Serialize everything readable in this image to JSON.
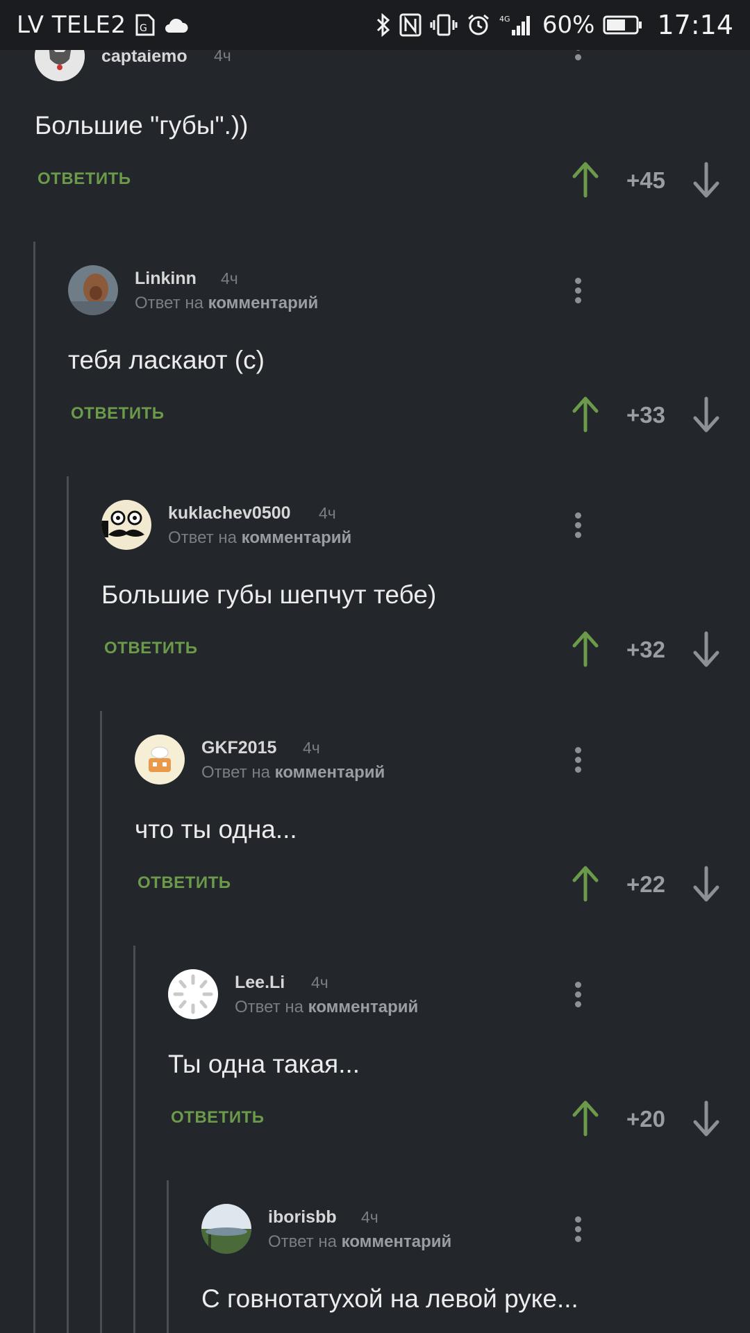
{
  "status_bar": {
    "carrier": "LV TELE2",
    "network": "4G",
    "battery_percent": "60%",
    "time": "17:14",
    "icons": [
      "sim-card-icon",
      "cloud-icon",
      "bluetooth-icon",
      "nfc-icon",
      "vibrate-icon",
      "alarm-icon",
      "signal-icon",
      "battery-icon"
    ]
  },
  "colors": {
    "background": "#23262b",
    "accent_green": "#6a9a4a",
    "muted": "#7b7e83"
  },
  "reply_label": "ОТВЕТИТЬ",
  "reply_prefix": "Ответ на",
  "reply_target": "комментарий",
  "comments": [
    {
      "author": "captaiemo",
      "time": "4ч",
      "text": "Большие \"губы\".))",
      "score": "+45",
      "is_reply": false
    },
    {
      "author": "Linkinn",
      "time": "4ч",
      "text": "тебя ласкают (с)",
      "score": "+33",
      "is_reply": true
    },
    {
      "author": "kuklachev0500",
      "time": "4ч",
      "text": "Большие губы шепчут тебе)",
      "score": "+32",
      "is_reply": true
    },
    {
      "author": "GKF2015",
      "time": "4ч",
      "text": "что ты одна...",
      "score": "+22",
      "is_reply": true
    },
    {
      "author": "Lee.Li",
      "time": "4ч",
      "text": "Ты одна такая...",
      "score": "+20",
      "is_reply": true
    },
    {
      "author": "iborisbb",
      "time": "4ч",
      "text": "С говнотатухой на левой руке...",
      "score": "",
      "is_reply": true
    }
  ]
}
